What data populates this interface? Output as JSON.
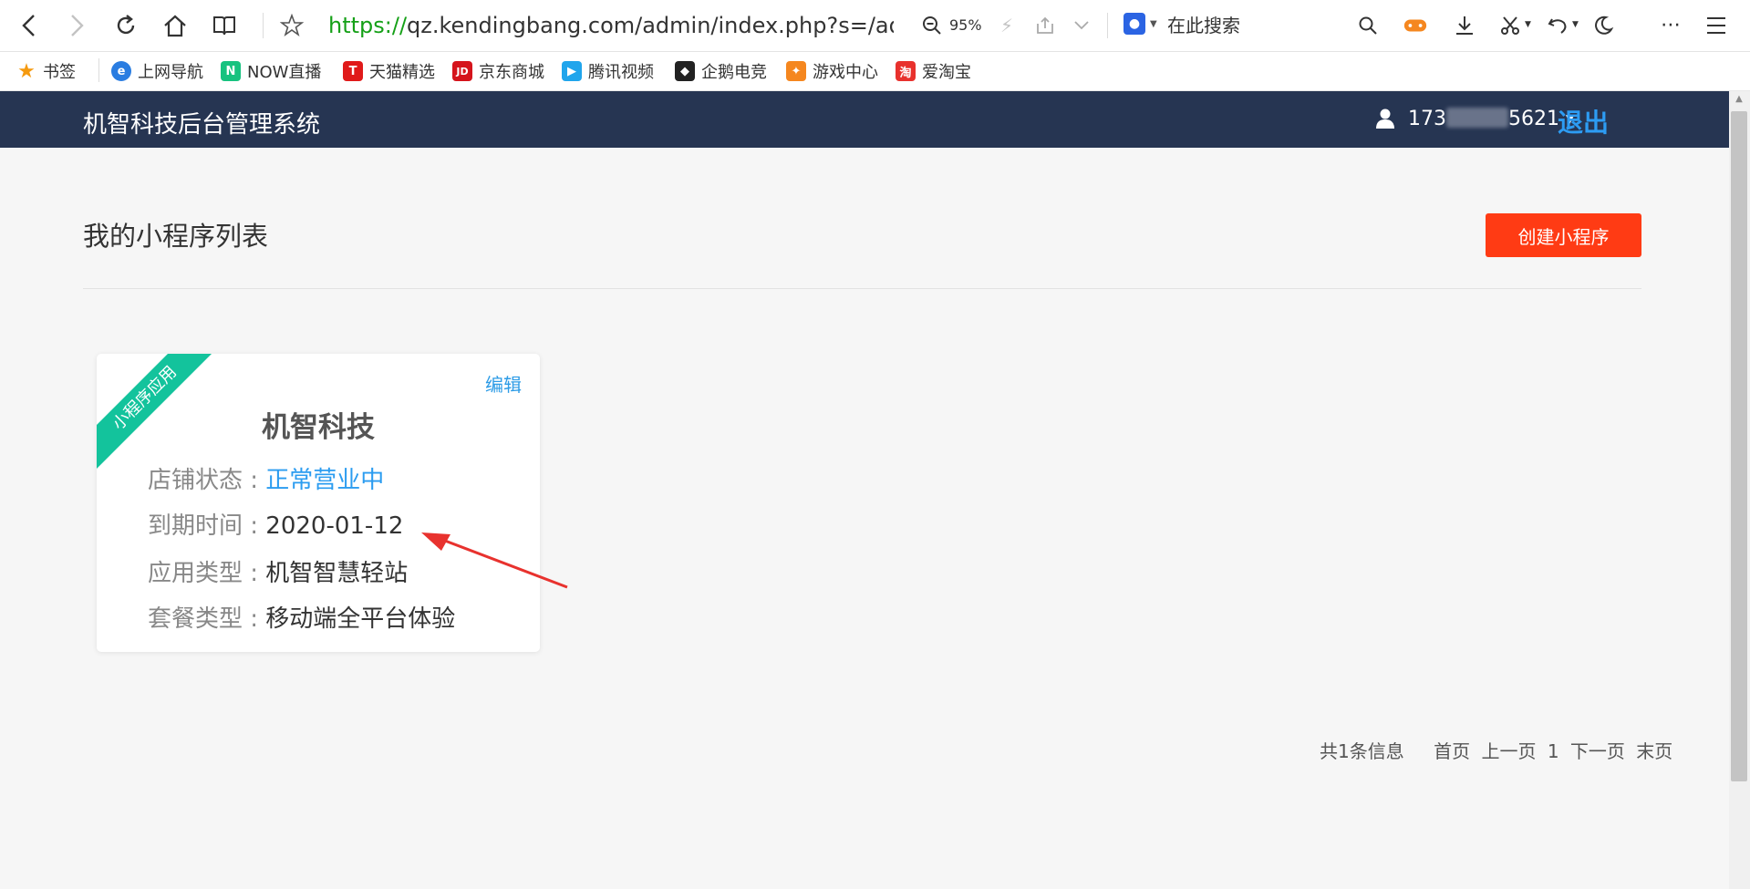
{
  "browser": {
    "url_protocol": "https://",
    "url_rest": "qz.kendingbang.com/admin/index.php?s=/admin/use",
    "zoom": "95%",
    "search_placeholder": "在此搜索"
  },
  "bookmarks": [
    {
      "label": "书签",
      "color": "#f59a0f",
      "glyph": "★"
    },
    {
      "label": "上网导航",
      "color": "#2a7de1",
      "glyph": "e"
    },
    {
      "label": "NOW直播",
      "color": "#17c27f",
      "glyph": "N"
    },
    {
      "label": "天猫精选",
      "color": "#e01a1a",
      "glyph": "T"
    },
    {
      "label": "京东商城",
      "color": "#d5141c",
      "glyph": "JD"
    },
    {
      "label": "腾讯视频",
      "color": "#20a5ec",
      "glyph": "▶"
    },
    {
      "label": "企鹅电竞",
      "color": "#222222",
      "glyph": "◆"
    },
    {
      "label": "游戏中心",
      "color": "#f5871f",
      "glyph": "✦"
    },
    {
      "label": "爱淘宝",
      "color": "#e8312d",
      "glyph": "淘"
    }
  ],
  "app": {
    "title": "机智科技后台管理系统",
    "user_phone_prefix": "173",
    "user_phone_suffix": "5621",
    "logout": "退出"
  },
  "content": {
    "page_title": "我的小程序列表",
    "create_button": "创建小程序"
  },
  "card": {
    "ribbon": "小程序应用",
    "edit": "编辑",
    "name": "机智科技",
    "rows": [
      {
        "label": "店铺状态 : ",
        "value": "正常营业中"
      },
      {
        "label": "到期时间 : ",
        "value": "2020-01-12"
      },
      {
        "label": "应用类型 : ",
        "value": "机智智慧轻站"
      },
      {
        "label": "套餐类型 : ",
        "value": "移动端全平台体验"
      }
    ]
  },
  "pagination": {
    "total": "共1条信息",
    "first": "首页",
    "prev": "上一页",
    "current": "1",
    "next": "下一页",
    "last": "末页"
  },
  "colors": {
    "header_bg": "#263552",
    "create_btn": "#ff3b14",
    "ribbon": "#13c39c",
    "link": "#2e9ce6",
    "annotation_arrow": "#e8322e"
  }
}
